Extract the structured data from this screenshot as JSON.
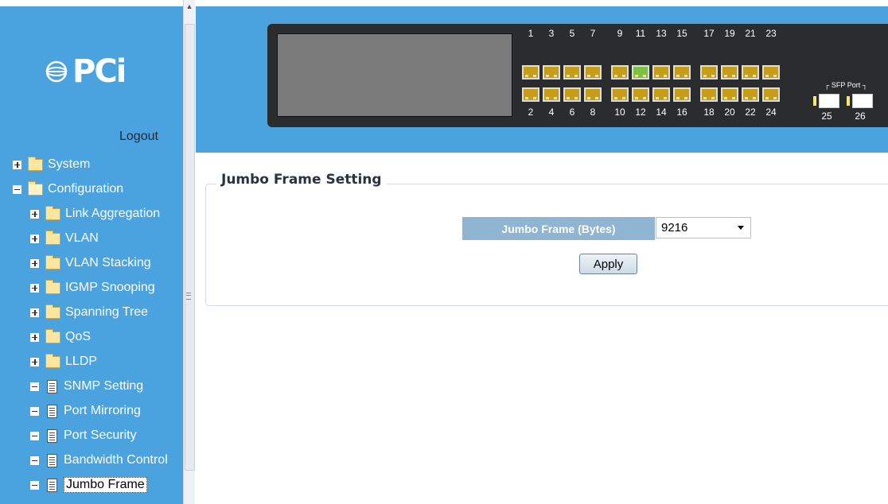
{
  "sidebar": {
    "logo_text": "PCi",
    "logout": "Logout",
    "tree": [
      {
        "label": "System",
        "expander": "plus",
        "icon": "folder"
      },
      {
        "label": "Configuration",
        "expander": "minus",
        "icon": "folder-open"
      },
      {
        "label": "Link Aggregation",
        "expander": "plus",
        "icon": "folder"
      },
      {
        "label": "VLAN",
        "expander": "plus",
        "icon": "folder"
      },
      {
        "label": "VLAN Stacking",
        "expander": "plus",
        "icon": "folder"
      },
      {
        "label": "IGMP Snooping",
        "expander": "plus",
        "icon": "folder"
      },
      {
        "label": "Spanning Tree",
        "expander": "plus",
        "icon": "folder"
      },
      {
        "label": "QoS",
        "expander": "plus",
        "icon": "folder"
      },
      {
        "label": "LLDP",
        "expander": "plus",
        "icon": "folder"
      },
      {
        "label": "SNMP Setting",
        "expander": "minus",
        "icon": "document"
      },
      {
        "label": "Port Mirroring",
        "expander": "minus",
        "icon": "document"
      },
      {
        "label": "Port Security",
        "expander": "minus",
        "icon": "document"
      },
      {
        "label": "Bandwidth Control",
        "expander": "minus",
        "icon": "document"
      },
      {
        "label": "Jumbo Frame",
        "expander": "minus",
        "icon": "document",
        "selected": true
      }
    ]
  },
  "switch_panel": {
    "top_ports": [
      "1",
      "3",
      "5",
      "7",
      "9",
      "11",
      "13",
      "15",
      "17",
      "19",
      "21",
      "23"
    ],
    "bottom_ports": [
      "2",
      "4",
      "6",
      "8",
      "10",
      "12",
      "14",
      "16",
      "18",
      "20",
      "22",
      "24"
    ],
    "active_port": "11",
    "sfp_label": "SFP Port",
    "sfp_ports": [
      "25",
      "26"
    ],
    "colors": {
      "port": "#c59d18",
      "active": "#7bc142",
      "banner": "#4aa3df"
    }
  },
  "content": {
    "section_title": "Jumbo Frame Setting",
    "field_label": "Jumbo Frame (Bytes)",
    "field_value": "9216",
    "apply_label": "Apply"
  }
}
